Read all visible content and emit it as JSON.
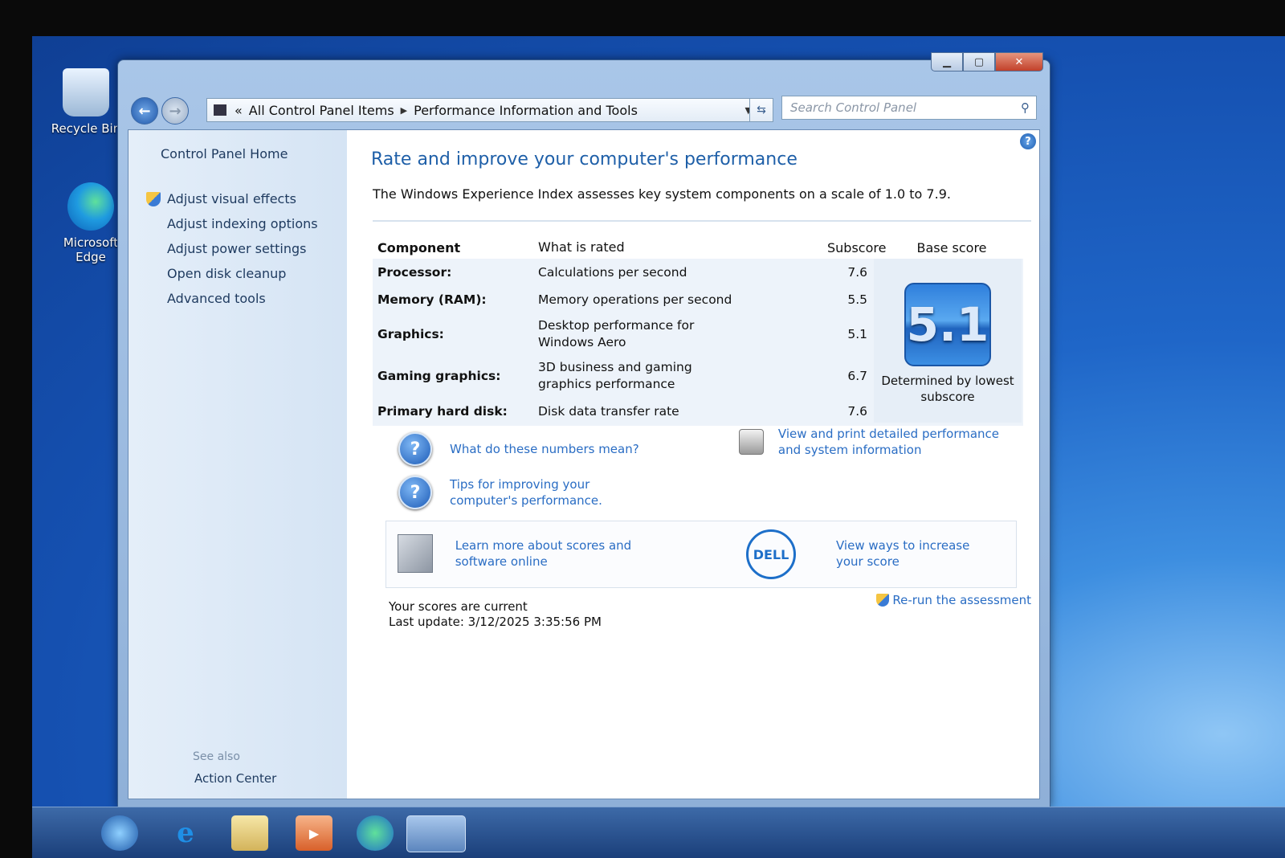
{
  "desktop": {
    "icons": [
      {
        "label": "Recycle Bin",
        "icon": "recycle-bin-icon"
      },
      {
        "label": "Microsoft Edge",
        "icon": "edge-icon"
      }
    ]
  },
  "window": {
    "address": {
      "prefix": "«",
      "crumbs": [
        "All Control Panel Items",
        "Performance Information and Tools"
      ]
    },
    "search_placeholder": "Search Control Panel"
  },
  "sidebar": {
    "home": "Control Panel Home",
    "items": [
      {
        "label": "Adjust visual effects",
        "shield": true
      },
      {
        "label": "Adjust indexing options"
      },
      {
        "label": "Adjust power settings"
      },
      {
        "label": "Open disk cleanup"
      },
      {
        "label": "Advanced tools"
      }
    ],
    "see_also": "See also",
    "action_center": "Action Center"
  },
  "main": {
    "title": "Rate and improve your computer's performance",
    "description": "The Windows Experience Index assesses key system components on a scale of 1.0 to 7.9.",
    "table": {
      "headers": [
        "Component",
        "What is rated",
        "Subscore",
        "Base score"
      ],
      "rows": [
        {
          "component": "Processor:",
          "rated": "Calculations per second",
          "subscore": "7.6"
        },
        {
          "component": "Memory (RAM):",
          "rated": "Memory operations per second",
          "subscore": "5.5"
        },
        {
          "component": "Graphics:",
          "rated": "Desktop performance for Windows Aero",
          "subscore": "5.1"
        },
        {
          "component": "Gaming graphics:",
          "rated": "3D business and gaming graphics performance",
          "subscore": "6.7"
        },
        {
          "component": "Primary hard disk:",
          "rated": "Disk data transfer rate",
          "subscore": "7.6"
        }
      ]
    },
    "base_score": "5.1",
    "base_score_caption": "Determined by lowest subscore",
    "links": {
      "numbers_mean": "What do these numbers mean?",
      "tips": "Tips for improving your computer's performance.",
      "view_print": "View and print detailed performance and system information",
      "learn_more": "Learn more about scores and software online",
      "increase_score": "View ways to increase your score",
      "dell_logo": "DELL"
    },
    "status": {
      "current": "Your scores are current",
      "last_update": "Last update: 3/12/2025 3:35:56 PM"
    },
    "rerun": "Re-run the assessment"
  }
}
